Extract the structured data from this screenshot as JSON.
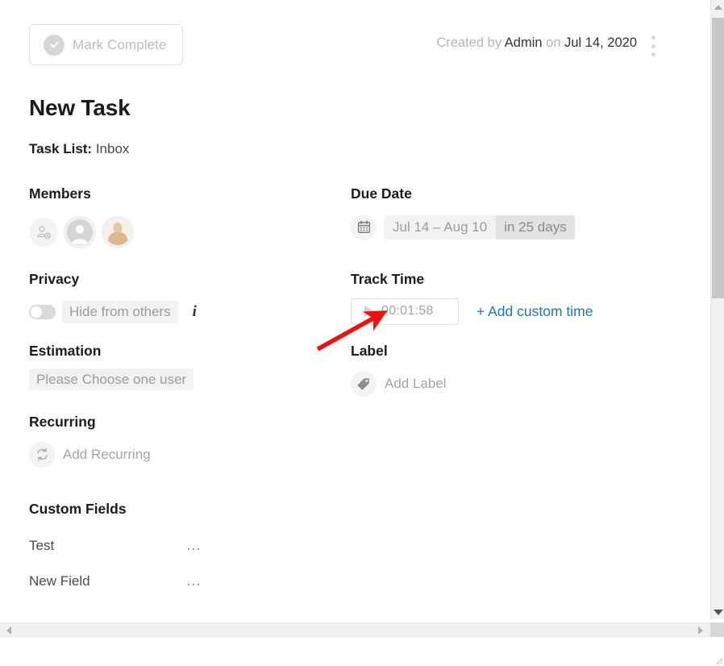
{
  "header": {
    "mark_complete_label": "Mark Complete",
    "mark_complete_icon": "check-circle-icon",
    "created_prefix": "Created by",
    "created_author": "Admin",
    "created_on": "on",
    "created_date": "Jul 14, 2020",
    "menu_icon": "kebab-menu-icon"
  },
  "task": {
    "title": "New Task",
    "task_list_label": "Task List:",
    "task_list_value": "Inbox"
  },
  "members": {
    "heading": "Members",
    "add_icon": "add-member-icon",
    "avatars": [
      {
        "name": "add-member-avatar",
        "type": "add"
      },
      {
        "name": "default-user-avatar",
        "type": "silhouette"
      },
      {
        "name": "user-photo-avatar",
        "type": "photo"
      }
    ]
  },
  "privacy": {
    "heading": "Privacy",
    "toggle_state": "off",
    "toggle_label": "Hide from others",
    "info_icon": "info-icon"
  },
  "estimation": {
    "heading": "Estimation",
    "placeholder": "Please Choose one user"
  },
  "recurring": {
    "heading": "Recurring",
    "icon": "refresh-loop-icon",
    "label": "Add Recurring"
  },
  "custom_fields": {
    "heading": "Custom Fields",
    "rows": [
      {
        "name": "Test",
        "menu_icon": "ellipsis-icon",
        "dots": "…"
      },
      {
        "name": "New Field",
        "menu_icon": "ellipsis-icon",
        "dots": "…"
      }
    ]
  },
  "due_date": {
    "heading": "Due Date",
    "icon": "calendar-icon",
    "range": "Jul 14  –  Aug 10",
    "relative": "in 25 days"
  },
  "track_time": {
    "heading": "Track Time",
    "play_icon": "play-icon",
    "timer_value": "00:01:58",
    "add_custom_label": "+ Add custom time"
  },
  "label": {
    "heading": "Label",
    "icon": "tag-icon",
    "add_label": "Add Label"
  },
  "annotation": {
    "type": "arrow",
    "color": "#ee1111",
    "points_to": "play-icon"
  },
  "scrollbars": {
    "vertical": {
      "up_icon": "caret-up-icon",
      "down_icon": "caret-down-icon"
    },
    "horizontal": {
      "left_icon": "caret-left-icon",
      "right_icon": "caret-right-icon"
    }
  },
  "colors": {
    "link": "#1a73c7",
    "heading": "#1c1c1c",
    "muted": "#a5a5a5",
    "annotation": "#ee1111"
  }
}
